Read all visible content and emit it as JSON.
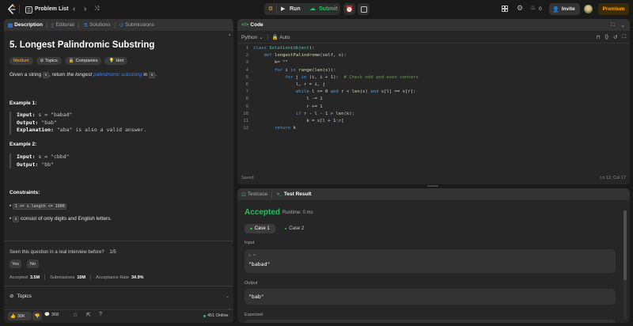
{
  "header": {
    "problem_list_label": "Problem List",
    "run_label": "Run",
    "submit_label": "Submit",
    "streak_count": "0",
    "invite_label": "Invite",
    "premium_label": "Premium"
  },
  "left": {
    "tabs": [
      "Description",
      "Editorial",
      "Solutions",
      "Submissions"
    ],
    "title": "5. Longest Palindromic Substring",
    "difficulty": "Medium",
    "tags": [
      "Topics",
      "Companies",
      "Hint"
    ],
    "desc_pre": "Given a string ",
    "desc_s": "s",
    "desc_mid": ", return ",
    "desc_em": "the longest",
    "desc_link": "palindromic substring",
    "desc_in": " in ",
    "desc_s2": "s",
    "desc_end": ".",
    "examples": [
      {
        "title": "Example 1:",
        "input_label": "Input:",
        "input": "s = \"babad\"",
        "output_label": "Output:",
        "output": "\"bab\"",
        "explanation_label": "Explanation:",
        "explanation": "\"aba\" is also a valid answer."
      },
      {
        "title": "Example 2:",
        "input_label": "Input:",
        "input": "s = \"cbbd\"",
        "output_label": "Output:",
        "output": "\"bb\""
      }
    ],
    "constraints_title": "Constraints:",
    "constraint1": "1 <= s.length <= 1000",
    "constraint2_code": "s",
    "constraint2_text": " consist of only digits and English letters.",
    "interview_q": "Seen this question in a real interview before?",
    "interview_frac": "1/5",
    "yes": "Yes",
    "no": "No",
    "accepted_label": "Accepted",
    "accepted_val": "3.5M",
    "submissions_label": "Submissions",
    "submissions_val": "10M",
    "rate_label": "Acceptance Rate",
    "rate_val": "34.9%",
    "topics_label": "Topics",
    "likes": "30K",
    "comments": "368",
    "online": "451 Online"
  },
  "code": {
    "tab_label": "Code",
    "language": "Python",
    "auto_label": "Auto",
    "saved": "Saved",
    "cursor": "Ln 12, Col 17",
    "lines": [
      "class Solution(object):",
      "    def longestPalindrome(self, s):",
      "        k= \"\"",
      "        for i in range(len(s)):",
      "            for j in (i, i + 1):  # Check odd and even centers",
      "                l, r = i, j",
      "                while l >= 0 and r < len(s) and s[l] == s[r]:",
      "                    l -= 1",
      "                    r += 1",
      "                if r - l - 1 > len(k):",
      "                    k = s[l + 1:r]",
      "        return k"
    ]
  },
  "result": {
    "testcase_tab": "Testcase",
    "result_tab": "Test Result",
    "status": "Accepted",
    "runtime": "Runtime: 0 ms",
    "case1": "Case 1",
    "case2": "Case 2",
    "input_label": "Input",
    "var": "s =",
    "input_val": "\"babad\"",
    "output_label": "Output",
    "output_val": "\"bab\"",
    "expected_label": "Expected"
  },
  "colors": {
    "accent_green": "#2cbb5d",
    "medium": "#ffb800",
    "link": "#3b82f6",
    "premium": "#ffa116"
  }
}
